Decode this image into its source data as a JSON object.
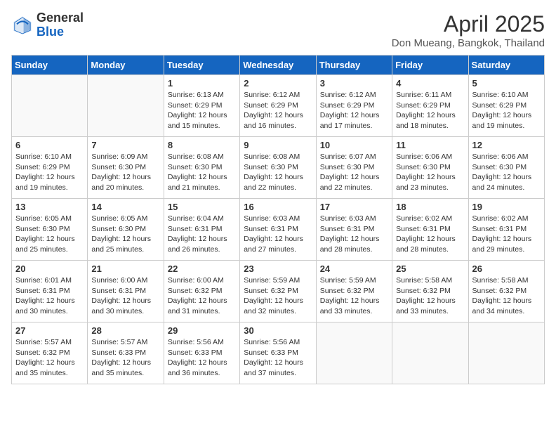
{
  "header": {
    "logo_general": "General",
    "logo_blue": "Blue",
    "month_title": "April 2025",
    "location": "Don Mueang, Bangkok, Thailand"
  },
  "days_of_week": [
    "Sunday",
    "Monday",
    "Tuesday",
    "Wednesday",
    "Thursday",
    "Friday",
    "Saturday"
  ],
  "weeks": [
    [
      {
        "day": "",
        "detail": ""
      },
      {
        "day": "",
        "detail": ""
      },
      {
        "day": "1",
        "detail": "Sunrise: 6:13 AM\nSunset: 6:29 PM\nDaylight: 12 hours and 15 minutes."
      },
      {
        "day": "2",
        "detail": "Sunrise: 6:12 AM\nSunset: 6:29 PM\nDaylight: 12 hours and 16 minutes."
      },
      {
        "day": "3",
        "detail": "Sunrise: 6:12 AM\nSunset: 6:29 PM\nDaylight: 12 hours and 17 minutes."
      },
      {
        "day": "4",
        "detail": "Sunrise: 6:11 AM\nSunset: 6:29 PM\nDaylight: 12 hours and 18 minutes."
      },
      {
        "day": "5",
        "detail": "Sunrise: 6:10 AM\nSunset: 6:29 PM\nDaylight: 12 hours and 19 minutes."
      }
    ],
    [
      {
        "day": "6",
        "detail": "Sunrise: 6:10 AM\nSunset: 6:29 PM\nDaylight: 12 hours and 19 minutes."
      },
      {
        "day": "7",
        "detail": "Sunrise: 6:09 AM\nSunset: 6:30 PM\nDaylight: 12 hours and 20 minutes."
      },
      {
        "day": "8",
        "detail": "Sunrise: 6:08 AM\nSunset: 6:30 PM\nDaylight: 12 hours and 21 minutes."
      },
      {
        "day": "9",
        "detail": "Sunrise: 6:08 AM\nSunset: 6:30 PM\nDaylight: 12 hours and 22 minutes."
      },
      {
        "day": "10",
        "detail": "Sunrise: 6:07 AM\nSunset: 6:30 PM\nDaylight: 12 hours and 22 minutes."
      },
      {
        "day": "11",
        "detail": "Sunrise: 6:06 AM\nSunset: 6:30 PM\nDaylight: 12 hours and 23 minutes."
      },
      {
        "day": "12",
        "detail": "Sunrise: 6:06 AM\nSunset: 6:30 PM\nDaylight: 12 hours and 24 minutes."
      }
    ],
    [
      {
        "day": "13",
        "detail": "Sunrise: 6:05 AM\nSunset: 6:30 PM\nDaylight: 12 hours and 25 minutes."
      },
      {
        "day": "14",
        "detail": "Sunrise: 6:05 AM\nSunset: 6:30 PM\nDaylight: 12 hours and 25 minutes."
      },
      {
        "day": "15",
        "detail": "Sunrise: 6:04 AM\nSunset: 6:31 PM\nDaylight: 12 hours and 26 minutes."
      },
      {
        "day": "16",
        "detail": "Sunrise: 6:03 AM\nSunset: 6:31 PM\nDaylight: 12 hours and 27 minutes."
      },
      {
        "day": "17",
        "detail": "Sunrise: 6:03 AM\nSunset: 6:31 PM\nDaylight: 12 hours and 28 minutes."
      },
      {
        "day": "18",
        "detail": "Sunrise: 6:02 AM\nSunset: 6:31 PM\nDaylight: 12 hours and 28 minutes."
      },
      {
        "day": "19",
        "detail": "Sunrise: 6:02 AM\nSunset: 6:31 PM\nDaylight: 12 hours and 29 minutes."
      }
    ],
    [
      {
        "day": "20",
        "detail": "Sunrise: 6:01 AM\nSunset: 6:31 PM\nDaylight: 12 hours and 30 minutes."
      },
      {
        "day": "21",
        "detail": "Sunrise: 6:00 AM\nSunset: 6:31 PM\nDaylight: 12 hours and 30 minutes."
      },
      {
        "day": "22",
        "detail": "Sunrise: 6:00 AM\nSunset: 6:32 PM\nDaylight: 12 hours and 31 minutes."
      },
      {
        "day": "23",
        "detail": "Sunrise: 5:59 AM\nSunset: 6:32 PM\nDaylight: 12 hours and 32 minutes."
      },
      {
        "day": "24",
        "detail": "Sunrise: 5:59 AM\nSunset: 6:32 PM\nDaylight: 12 hours and 33 minutes."
      },
      {
        "day": "25",
        "detail": "Sunrise: 5:58 AM\nSunset: 6:32 PM\nDaylight: 12 hours and 33 minutes."
      },
      {
        "day": "26",
        "detail": "Sunrise: 5:58 AM\nSunset: 6:32 PM\nDaylight: 12 hours and 34 minutes."
      }
    ],
    [
      {
        "day": "27",
        "detail": "Sunrise: 5:57 AM\nSunset: 6:32 PM\nDaylight: 12 hours and 35 minutes."
      },
      {
        "day": "28",
        "detail": "Sunrise: 5:57 AM\nSunset: 6:33 PM\nDaylight: 12 hours and 35 minutes."
      },
      {
        "day": "29",
        "detail": "Sunrise: 5:56 AM\nSunset: 6:33 PM\nDaylight: 12 hours and 36 minutes."
      },
      {
        "day": "30",
        "detail": "Sunrise: 5:56 AM\nSunset: 6:33 PM\nDaylight: 12 hours and 37 minutes."
      },
      {
        "day": "",
        "detail": ""
      },
      {
        "day": "",
        "detail": ""
      },
      {
        "day": "",
        "detail": ""
      }
    ]
  ]
}
